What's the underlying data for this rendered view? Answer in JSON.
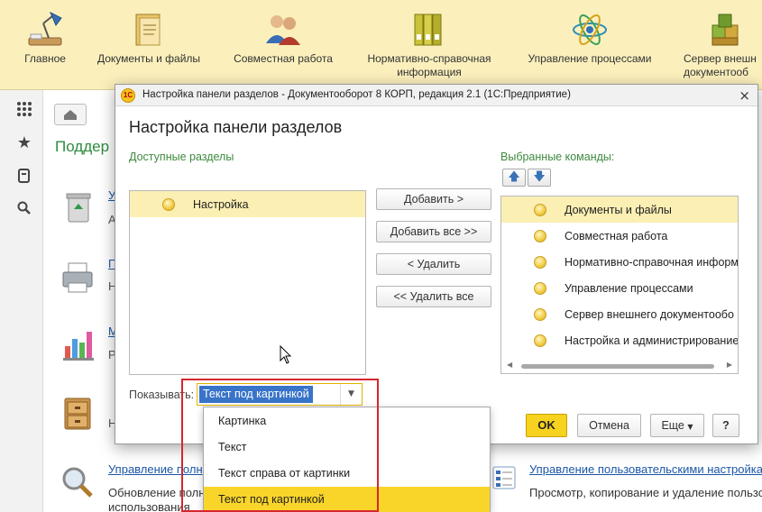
{
  "sections_panel": {
    "items": [
      {
        "label": "Главное",
        "icon": "desk-lamp-icon"
      },
      {
        "label": "Документы и файлы",
        "icon": "document-folder-icon"
      },
      {
        "label": "Совместная работа",
        "icon": "people-icon"
      },
      {
        "label": "Нормативно-справочная",
        "label2": "информация",
        "icon": "binders-icon"
      },
      {
        "label": "Управление процессами",
        "icon": "process-atom-icon"
      },
      {
        "label": "Сервер внешн",
        "label2": "документооб",
        "icon": "cubes-icon"
      }
    ]
  },
  "background": {
    "title": "Поддер",
    "letters": [
      "У",
      "А",
      "П",
      "Н",
      "М",
      "Р",
      "Н"
    ],
    "link_main": "Управление полн",
    "text_main": [
      "Обновление полн",
      "использования"
    ],
    "link_right": "Управление пользовательскими настройкам",
    "text_right": "Просмотр, копирование и удаление пользо"
  },
  "dialog": {
    "window_title": "Настройка панели разделов - Документооборот 8 КОРП, редакция 2.1  (1С:Предприятие)",
    "logo_text": "1C",
    "heading": "Настройка панели разделов",
    "available_label": "Доступные разделы",
    "selected_label": "Выбранные команды:",
    "available_items": [
      "Настройка"
    ],
    "selected_items": [
      "Документы и файлы",
      "Совместная работа",
      "Нормативно-справочная информ",
      "Управление процессами",
      "Сервер внешнего документообо",
      "Настройка и администрирование"
    ],
    "buttons": {
      "add": "Добавить >",
      "add_all": "Добавить все >>",
      "remove": "< Удалить",
      "remove_all": "<< Удалить все",
      "ok": "OK",
      "cancel": "Отмена",
      "more": "Еще",
      "help": "?"
    },
    "show_label": "Показывать:",
    "show_value": "Текст под картинкой"
  },
  "dropdown": {
    "options": [
      "Картинка",
      "Текст",
      "Текст справа от картинки",
      "Текст под картинкой"
    ],
    "selected": "Текст под картинкой"
  },
  "colors": {
    "panel_bg": "#fbf0bc",
    "accent_yellow": "#f7d21e",
    "group_label_green": "#3d8a3e",
    "selection_blue": "#3874c8",
    "highlight_red": "#d6262e"
  }
}
